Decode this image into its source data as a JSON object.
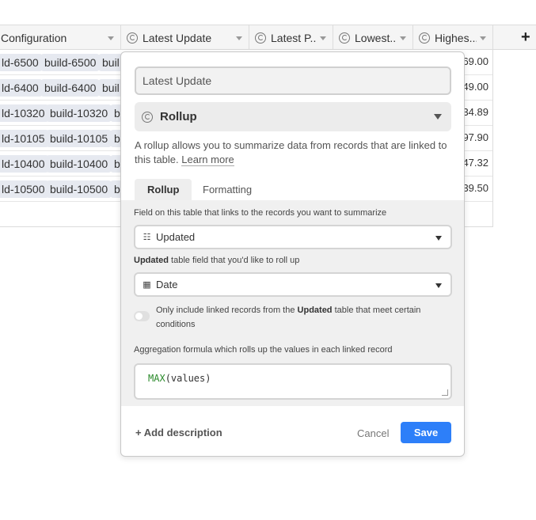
{
  "grid": {
    "columns": [
      {
        "label": "Configuration",
        "icon": "none"
      },
      {
        "label": "Latest Update",
        "icon": "rollup-spiral-icon"
      },
      {
        "label": "Latest P...",
        "icon": "rollup-spiral-icon"
      },
      {
        "label": "Lowest...",
        "icon": "rollup-spiral-icon"
      },
      {
        "label": "Highes...",
        "icon": "rollup-spiral-icon"
      }
    ],
    "add_column": "+",
    "rows": [
      {
        "chip1": "ld-6500",
        "chip2": "build-6500",
        "chip3": "buil",
        "value": "69.00"
      },
      {
        "chip1": "ld-6400",
        "chip2": "build-6400",
        "chip3": "buil",
        "value": "49.00"
      },
      {
        "chip1": "ld-10320",
        "chip2": "build-10320",
        "chip3": "b",
        "value": "34.89"
      },
      {
        "chip1": "ld-10105",
        "chip2": "build-10105",
        "chip3": "b",
        "value": "97.90"
      },
      {
        "chip1": "ld-10400",
        "chip2": "build-10400",
        "chip3": "b",
        "value": "47.32"
      },
      {
        "chip1": "ld-10500",
        "chip2": "build-10500",
        "chip3": "b",
        "value": "39.50"
      }
    ]
  },
  "dialog": {
    "field_name": "Latest Update",
    "field_type": "Rollup",
    "description": "A rollup allows you to summarize data from records that are linked to this table.",
    "learn_more": "Learn more",
    "tabs": [
      "Rollup",
      "Formatting"
    ],
    "link_field_label": "Field on this table that links to the records you want to summarize",
    "link_field_value": "Updated",
    "rollup_field_label_bold": "Updated",
    "rollup_field_label_rest": " table field that you'd like to roll up",
    "rollup_field_value": "Date",
    "condition_label_1": "Only include linked records from the ",
    "condition_label_bold": "Updated",
    "condition_label_2": " table that meet certain conditions",
    "aggregation_label": "Aggregation formula which rolls up the values in each linked record",
    "formula_fn": "MAX",
    "formula_args": "(values)",
    "add_description": "+ Add description",
    "cancel": "Cancel",
    "save": "Save"
  },
  "colors": {
    "accent": "#2d7ff9",
    "formula_function": "#2a8a2a"
  }
}
